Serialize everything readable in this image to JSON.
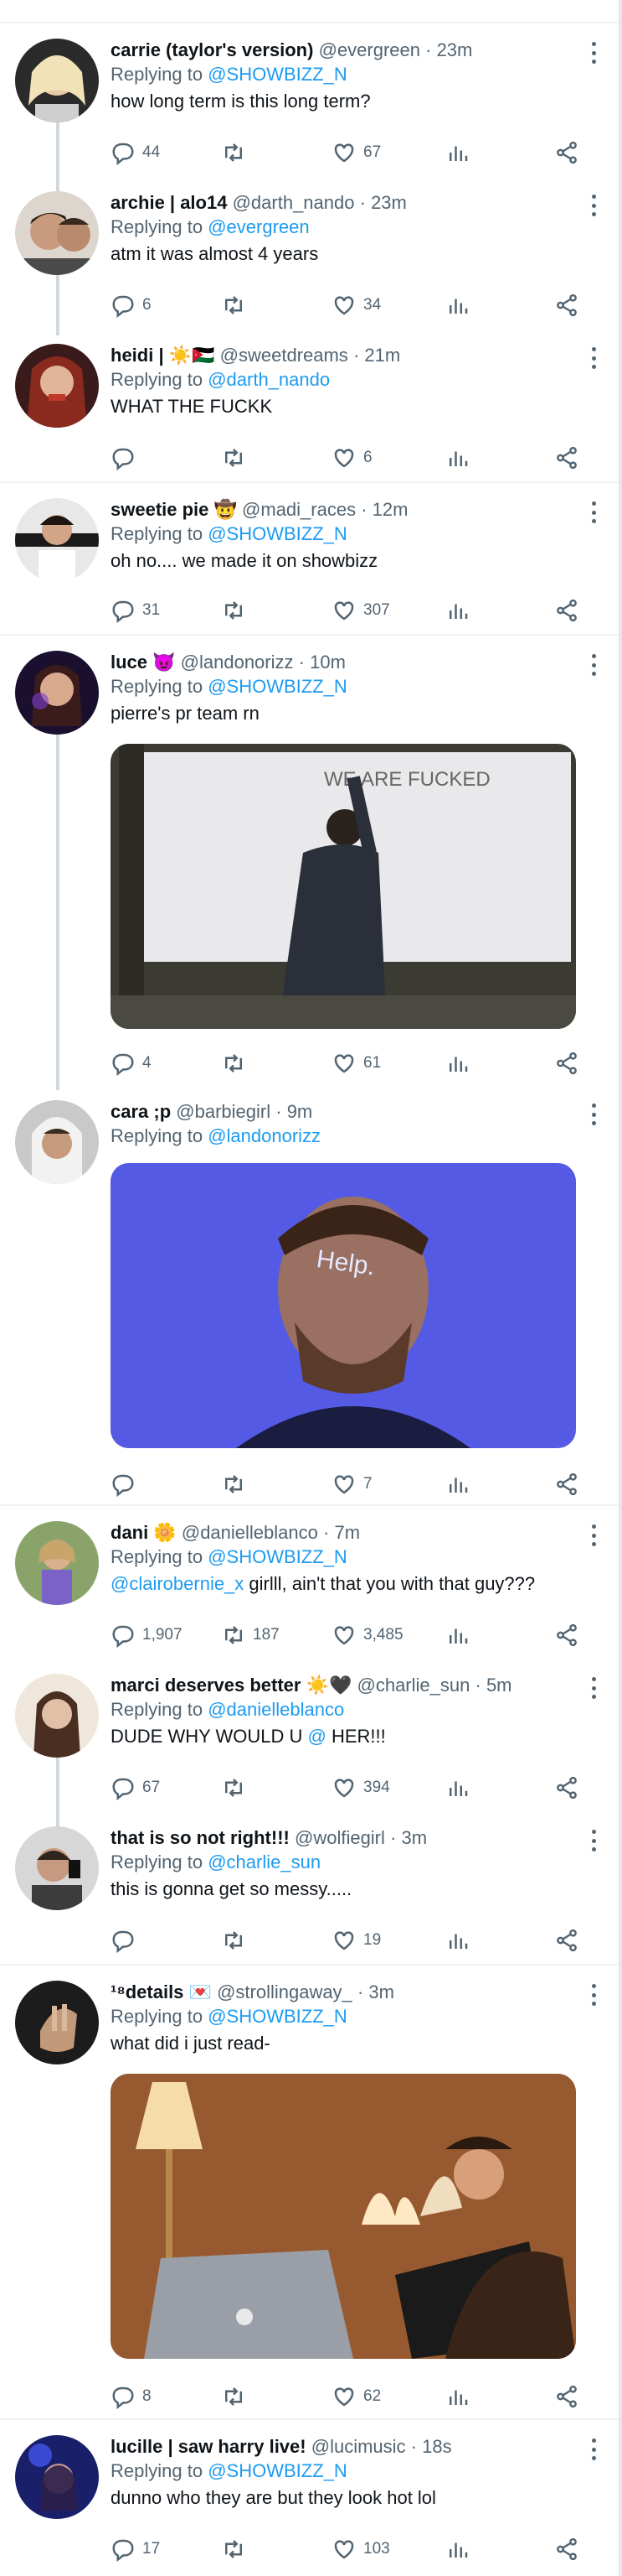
{
  "tweets": [
    {
      "name": "carrie (taylor's version)",
      "handle": "@evergreen",
      "time": "23m",
      "replying_label": "Replying to",
      "replying_to": "@SHOWBIZZ_N",
      "text": "how long term is this long term?",
      "replies": "44",
      "retweets": "",
      "likes": "67"
    },
    {
      "name": "archie | alo14",
      "handle": "@darth_nando",
      "time": "23m",
      "replying_label": "Replying to",
      "replying_to": "@evergreen",
      "text": "atm it was almost 4 years",
      "replies": "6",
      "retweets": "",
      "likes": "34"
    },
    {
      "name": "heidi | ☀️🇯🇴",
      "handle": "@sweetdreams",
      "time": "21m",
      "replying_label": "Replying to",
      "replying_to": "@darth_nando",
      "text": "WHAT THE FUCKK",
      "replies": "",
      "retweets": "",
      "likes": "6"
    },
    {
      "name": "sweetie pie 🤠",
      "handle": "@madi_races",
      "time": "12m",
      "replying_label": "Replying to",
      "replying_to": "@SHOWBIZZ_N",
      "text": "oh no.... we made it on showbizz",
      "replies": "31",
      "retweets": "",
      "likes": "307"
    },
    {
      "name": "luce 😈",
      "handle": "@landonorizz",
      "time": "10m",
      "replying_label": "Replying to",
      "replying_to": "@SHOWBIZZ_N",
      "text": "pierre's pr team rn",
      "media_text": "WE ARE FUCKED",
      "replies": "4",
      "retweets": "",
      "likes": "61"
    },
    {
      "name": "cara ;p",
      "handle": "@barbiegirl",
      "time": "9m",
      "replying_label": "Replying to",
      "replying_to": "@landonorizz",
      "text": "",
      "media_text": "Help.",
      "replies": "",
      "retweets": "",
      "likes": "7"
    },
    {
      "name": "dani 🌼",
      "handle": "@danielleblanco",
      "time": "7m",
      "replying_label": "Replying to",
      "replying_to": "@SHOWBIZZ_N",
      "text_mention": "@clairobernie_x",
      "text": " girlll, ain't that you with that guy???",
      "replies": "1,907",
      "retweets": "187",
      "likes": "3,485"
    },
    {
      "name": "marci deserves better ☀️🖤",
      "handle": "@charlie_sun",
      "time": "5m",
      "replying_label": "Replying to",
      "replying_to": "@danielleblanco",
      "text": "DUDE WHY WOULD U ",
      "text_mention_tail": "@",
      "text_after": " HER!!!",
      "replies": "67",
      "retweets": "",
      "likes": "394"
    },
    {
      "name": "that is so not right!!!",
      "handle": "@wolfiegirl",
      "time": "3m",
      "replying_label": "Replying to",
      "replying_to": "@charlie_sun",
      "text": "this is gonna get so messy.....",
      "replies": "",
      "retweets": "",
      "likes": "19"
    },
    {
      "name": "¹⁸details 💌",
      "handle": "@strollingaway_",
      "time": "3m",
      "replying_label": "Replying to",
      "replying_to": "@SHOWBIZZ_N",
      "text": "what did i just read-",
      "replies": "8",
      "retweets": "",
      "likes": "62"
    },
    {
      "name": "lucille | saw harry live!",
      "handle": "@lucimusic",
      "time": "18s",
      "replying_label": "Replying to",
      "replying_to": "@SHOWBIZZ_N",
      "text": "dunno who they are but they look hot lol",
      "replies": "17",
      "retweets": "",
      "likes": "103"
    }
  ],
  "dot": "·",
  "icons": [
    "reply-icon",
    "retweet-icon",
    "like-icon",
    "views-icon",
    "share-icon",
    "more-icon"
  ]
}
